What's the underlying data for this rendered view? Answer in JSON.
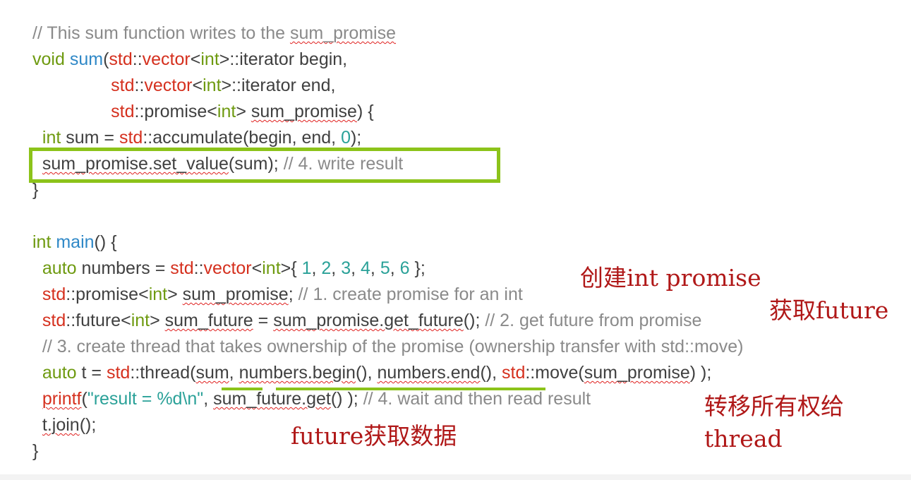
{
  "colors": {
    "keyword": "#6e9a10",
    "std": "#d5301e",
    "function": "#2f88c7",
    "number": "#2aa198",
    "comment": "#8a8a8a",
    "plain": "#404040",
    "highlight": "#8cc31a",
    "annotation": "#b01818"
  },
  "code_lines": [
    [
      [
        "com",
        "// This sum function writes to the "
      ],
      [
        "com",
        "sum_promise",
        1
      ]
    ],
    [
      [
        "kw",
        "void"
      ],
      [
        "plain",
        " "
      ],
      [
        "fn",
        "sum"
      ],
      [
        "plain",
        "("
      ],
      [
        "std",
        "std"
      ],
      [
        "plain",
        "::"
      ],
      [
        "std",
        "vector"
      ],
      [
        "plain",
        "<"
      ],
      [
        "kw",
        "int"
      ],
      [
        "plain",
        ">::iterator begin,"
      ]
    ],
    [
      [
        "plain",
        "                "
      ],
      [
        "std",
        "std"
      ],
      [
        "plain",
        "::"
      ],
      [
        "std",
        "vector"
      ],
      [
        "plain",
        "<"
      ],
      [
        "kw",
        "int"
      ],
      [
        "plain",
        ">::iterator end,"
      ]
    ],
    [
      [
        "plain",
        "                "
      ],
      [
        "std",
        "std"
      ],
      [
        "plain",
        "::promise<"
      ],
      [
        "kw",
        "int"
      ],
      [
        "plain",
        "> "
      ],
      [
        "plain",
        "sum_promise",
        1
      ],
      [
        "plain",
        ") {"
      ]
    ],
    [
      [
        "plain",
        "  "
      ],
      [
        "kw",
        "int"
      ],
      [
        "plain",
        " sum = "
      ],
      [
        "std",
        "std"
      ],
      [
        "plain",
        "::accumulate(begin, end, "
      ],
      [
        "num",
        "0"
      ],
      [
        "plain",
        ");"
      ]
    ],
    [
      [
        "plain",
        "  "
      ],
      [
        "plain",
        "sum_promise.set_value",
        1
      ],
      [
        "plain",
        "(sum); "
      ],
      [
        "com",
        "// 4. write result"
      ]
    ],
    [
      [
        "plain",
        "}"
      ]
    ],
    [
      [
        "plain",
        ""
      ]
    ],
    [
      [
        "kw",
        "int"
      ],
      [
        "plain",
        " "
      ],
      [
        "fn",
        "main"
      ],
      [
        "plain",
        "() {"
      ]
    ],
    [
      [
        "plain",
        "  "
      ],
      [
        "kw",
        "auto"
      ],
      [
        "plain",
        " numbers = "
      ],
      [
        "std",
        "std"
      ],
      [
        "plain",
        "::"
      ],
      [
        "std",
        "vector"
      ],
      [
        "plain",
        "<"
      ],
      [
        "kw",
        "int"
      ],
      [
        "plain",
        ">{ "
      ],
      [
        "num",
        "1"
      ],
      [
        "plain",
        ", "
      ],
      [
        "num",
        "2"
      ],
      [
        "plain",
        ", "
      ],
      [
        "num",
        "3"
      ],
      [
        "plain",
        ", "
      ],
      [
        "num",
        "4"
      ],
      [
        "plain",
        ", "
      ],
      [
        "num",
        "5"
      ],
      [
        "plain",
        ", "
      ],
      [
        "num",
        "6"
      ],
      [
        "plain",
        " };"
      ]
    ],
    [
      [
        "plain",
        "  "
      ],
      [
        "std",
        "std"
      ],
      [
        "plain",
        "::promise<"
      ],
      [
        "kw",
        "int"
      ],
      [
        "plain",
        "> "
      ],
      [
        "plain",
        "sum_promise",
        1
      ],
      [
        "plain",
        "; "
      ],
      [
        "com",
        "// 1. create promise for an int"
      ]
    ],
    [
      [
        "plain",
        "  "
      ],
      [
        "std",
        "std"
      ],
      [
        "plain",
        "::future<"
      ],
      [
        "kw",
        "int"
      ],
      [
        "plain",
        "> "
      ],
      [
        "plain",
        "sum_future",
        1
      ],
      [
        "plain",
        " = "
      ],
      [
        "plain",
        "sum_promise.get_future",
        1
      ],
      [
        "plain",
        "(); "
      ],
      [
        "com",
        "// 2. get future from promise"
      ]
    ],
    [
      [
        "plain",
        "  "
      ],
      [
        "com",
        "// 3. create thread that takes ownership of the promise (ownership transfer with std::move)"
      ]
    ],
    [
      [
        "plain",
        "  "
      ],
      [
        "kw",
        "auto"
      ],
      [
        "plain",
        " t = "
      ],
      [
        "std",
        "std"
      ],
      [
        "plain",
        "::thread("
      ],
      [
        "plain",
        "sum",
        1
      ],
      [
        "plain",
        ", "
      ],
      [
        "plain",
        "numbers.begin",
        1
      ],
      [
        "plain",
        "(), "
      ],
      [
        "plain",
        "numbers.end",
        1
      ],
      [
        "plain",
        "(), "
      ],
      [
        "std",
        "std"
      ],
      [
        "plain",
        "::move("
      ],
      [
        "plain",
        "sum_promise",
        1
      ],
      [
        "plain",
        ") );"
      ]
    ],
    [
      [
        "plain",
        "  "
      ],
      [
        "std",
        "printf",
        1
      ],
      [
        "plain",
        "("
      ],
      [
        "str",
        "\"result = %d\\n\""
      ],
      [
        "plain",
        ", "
      ],
      [
        "plain",
        "sum_future.get",
        1
      ],
      [
        "plain",
        "() ); "
      ],
      [
        "com",
        "// 4. wait and then read result"
      ]
    ],
    [
      [
        "plain",
        "  "
      ],
      [
        "plain",
        "t.join",
        1
      ],
      [
        "plain",
        "();"
      ]
    ],
    [
      [
        "plain",
        "}"
      ]
    ]
  ],
  "annotations": {
    "create_promise": "创建int promise",
    "get_future": "获取future",
    "transfer_ownership_line1": "转移所有权给",
    "transfer_ownership_line2": "thread",
    "future_get_data": "future获取数据"
  }
}
